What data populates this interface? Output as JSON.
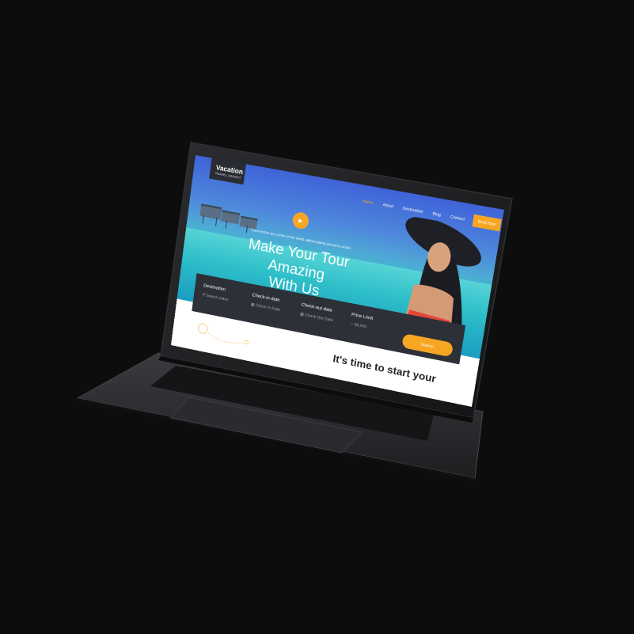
{
  "site": {
    "logo_main": "Vacation",
    "logo_sub": "TRAVEL AGENCY"
  },
  "nav": {
    "items": [
      "Home",
      "About",
      "Destination",
      "Blog",
      "Contact"
    ],
    "active_index": 0,
    "cta_label": "Book Now"
  },
  "hero": {
    "tagline": "Travel to the any corner of the world, without going around in circles",
    "headline_line1": "Make Your Tour Amazing",
    "headline_line2": "With Us",
    "play_icon": "play-icon"
  },
  "search": {
    "fields": [
      {
        "label": "Destination",
        "value": "Search place",
        "icon": "pin-icon"
      },
      {
        "label": "Check-in date",
        "value": "Check In Date",
        "icon": "calendar-icon"
      },
      {
        "label": "Check-out date",
        "value": "Check Out Date",
        "icon": "calendar-icon"
      },
      {
        "label": "Price Limit",
        "value": "$5,000",
        "icon": "dollar-icon"
      }
    ],
    "button_label": "Search"
  },
  "section": {
    "title": "It's time to start your"
  },
  "colors": {
    "accent": "#f6a623",
    "panel": "#2e3038",
    "background": "#0d0d0e"
  }
}
